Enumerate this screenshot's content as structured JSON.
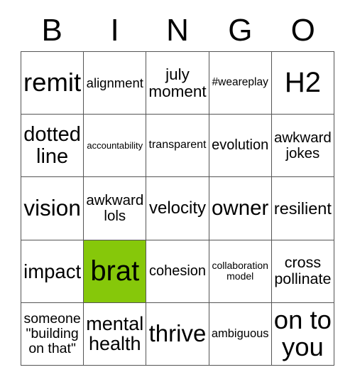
{
  "header": {
    "letters": [
      "B",
      "I",
      "N",
      "G",
      "O"
    ]
  },
  "grid": {
    "columns": 5,
    "rows": 5,
    "marked_color": "#86c80a",
    "border_color": "#555555",
    "background_color": "#ffffff",
    "cells": [
      {
        "text": "remit",
        "marked": false
      },
      {
        "text": "alignment",
        "marked": false
      },
      {
        "text": "july\nmoment",
        "marked": false
      },
      {
        "text": "#weareplay",
        "marked": false
      },
      {
        "text": "H2",
        "marked": false
      },
      {
        "text": "dotted\nline",
        "marked": false
      },
      {
        "text": "accountability",
        "marked": false
      },
      {
        "text": "transparent",
        "marked": false
      },
      {
        "text": "evolution",
        "marked": false
      },
      {
        "text": "awkward\njokes",
        "marked": false
      },
      {
        "text": "vision",
        "marked": false
      },
      {
        "text": "awkward\nlols",
        "marked": false
      },
      {
        "text": "velocity",
        "marked": false
      },
      {
        "text": "owner",
        "marked": false
      },
      {
        "text": "resilient",
        "marked": false
      },
      {
        "text": "impact",
        "marked": false
      },
      {
        "text": "brat",
        "marked": true
      },
      {
        "text": "cohesion",
        "marked": false
      },
      {
        "text": "collaboration\nmodel",
        "marked": false
      },
      {
        "text": "cross\npollinate",
        "marked": false
      },
      {
        "text": "someone\n\"building\non that\"",
        "marked": false
      },
      {
        "text": "mental\nhealth",
        "marked": false
      },
      {
        "text": "thrive",
        "marked": false
      },
      {
        "text": "ambiguous",
        "marked": false
      },
      {
        "text": "on to\nyou",
        "marked": false
      }
    ]
  }
}
